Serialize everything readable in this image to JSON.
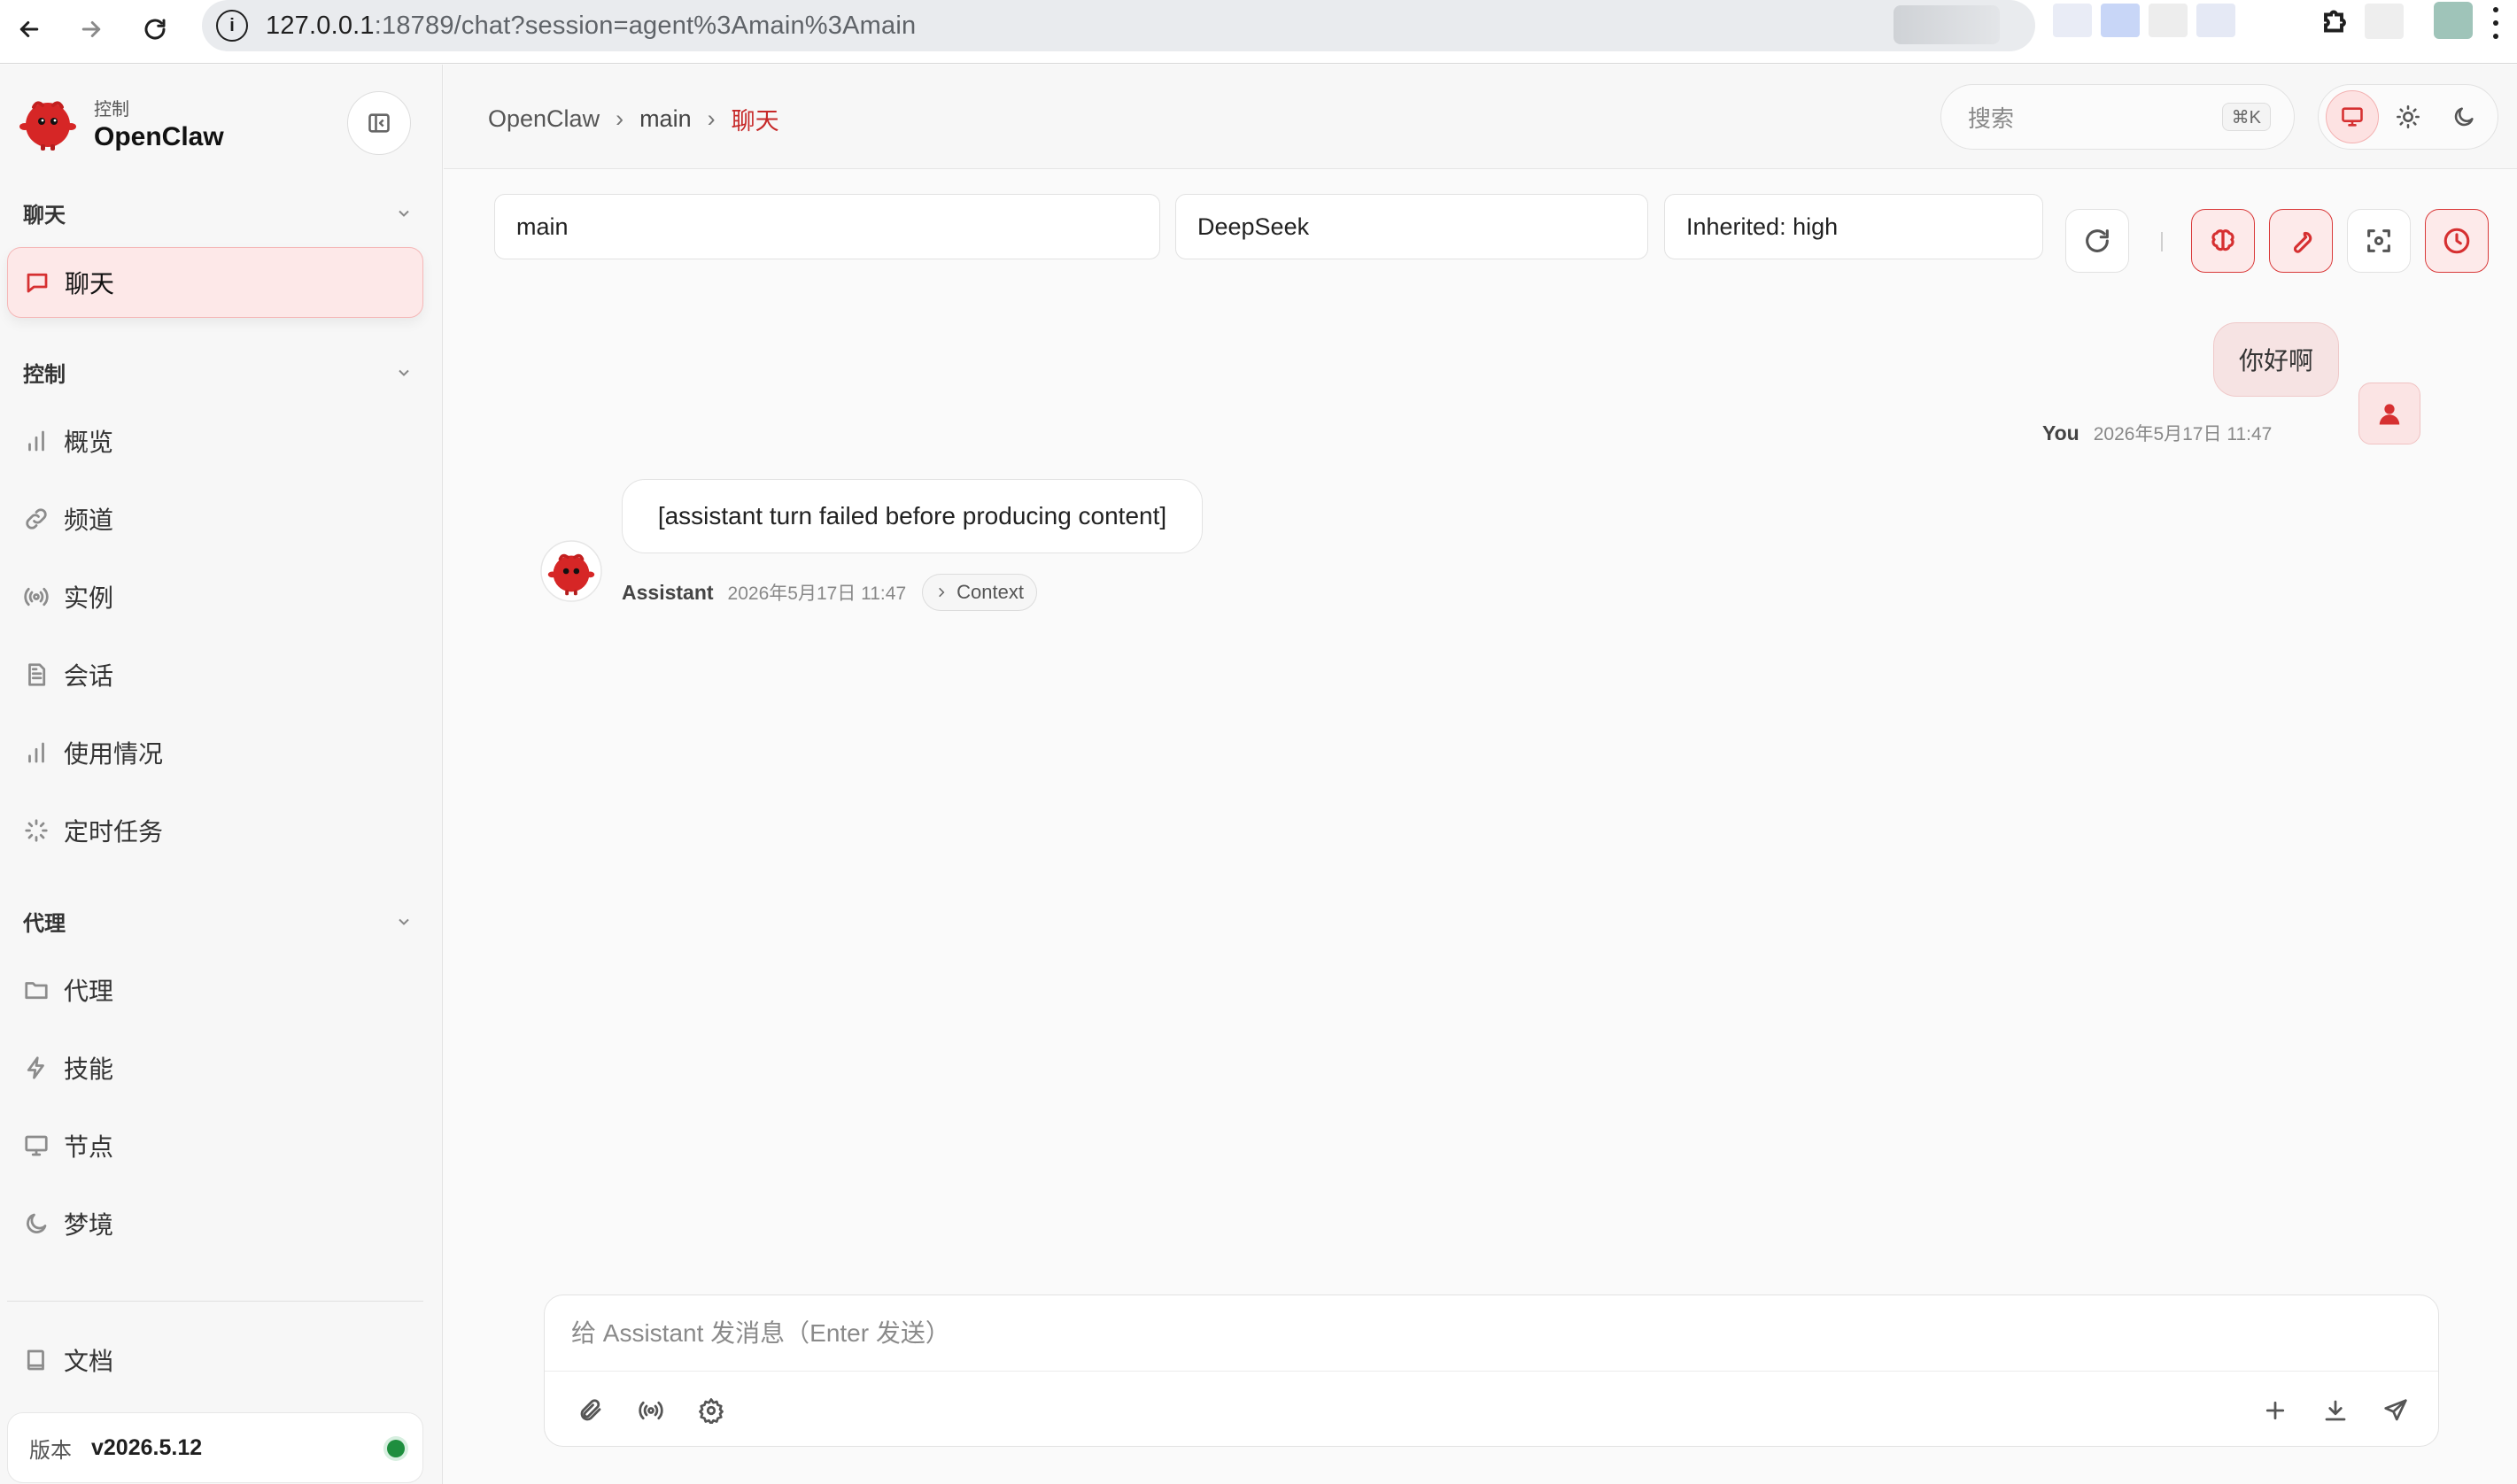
{
  "browser": {
    "url_host": "127.0.0.1",
    "url_rest": ":18789/chat?session=agent%3Amain%3Amain"
  },
  "sidebar": {
    "brand_sub": "控制",
    "brand_name": "OpenClaw",
    "groups": [
      {
        "label": "聊天",
        "items": [
          {
            "label": "聊天",
            "icon": "message-square-icon",
            "active": true
          }
        ]
      },
      {
        "label": "控制",
        "items": [
          {
            "label": "概览",
            "icon": "bar-chart-icon"
          },
          {
            "label": "频道",
            "icon": "link-icon"
          },
          {
            "label": "实例",
            "icon": "radio-icon"
          },
          {
            "label": "会话",
            "icon": "file-text-icon"
          },
          {
            "label": "使用情况",
            "icon": "bar-chart-icon"
          },
          {
            "label": "定时任务",
            "icon": "loader-icon"
          }
        ]
      },
      {
        "label": "代理",
        "items": [
          {
            "label": "代理",
            "icon": "folder-icon"
          },
          {
            "label": "技能",
            "icon": "zap-icon"
          },
          {
            "label": "节点",
            "icon": "monitor-icon"
          },
          {
            "label": "梦境",
            "icon": "moon-icon"
          }
        ]
      }
    ],
    "docs_label": "文档",
    "version_label": "版本",
    "version_value": "v2026.5.12",
    "status_color": "#1e8e3e"
  },
  "topbar": {
    "crumbs": [
      "OpenClaw",
      "main",
      "聊天"
    ],
    "search_placeholder": "搜索",
    "search_shortcut": "⌘K",
    "theme_modes": [
      "system",
      "light",
      "dark"
    ],
    "active_theme": "system"
  },
  "session": {
    "agent": "main",
    "model": "DeepSeek",
    "thinking": "Inherited: high"
  },
  "messages": {
    "user": {
      "text": "你好啊",
      "name": "You",
      "time": "2026年5月17日 11:47"
    },
    "assistant": {
      "text": "[assistant turn failed before producing content]",
      "name": "Assistant",
      "time": "2026年5月17日 11:47",
      "context_label": "Context"
    }
  },
  "composer": {
    "placeholder": "给 Assistant 发消息（Enter 发送）"
  },
  "colors": {
    "accent": "#d63031",
    "accent_bg": "#fde8e8"
  }
}
